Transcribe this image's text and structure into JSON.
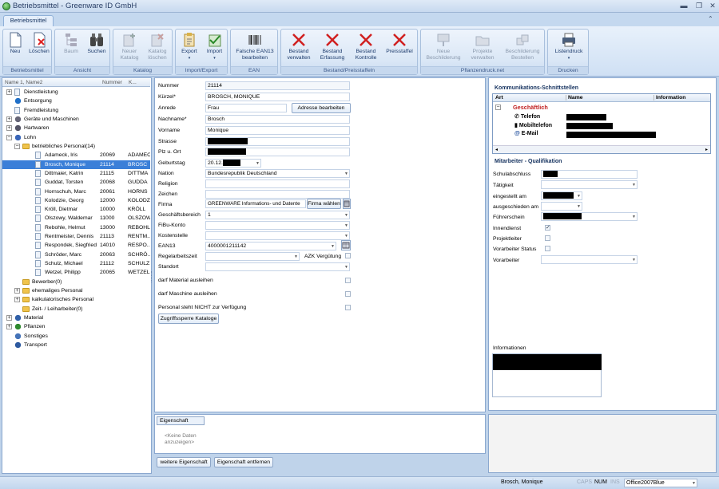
{
  "window": {
    "title": "Betriebsmittel - Greenware ID GmbH"
  },
  "ribbon": {
    "tab": "Betriebsmittel",
    "groups": [
      {
        "caption": "Betriebsmittel",
        "buttons": [
          "Neu",
          "Löschen"
        ]
      },
      {
        "caption": "Ansicht",
        "buttons": [
          "Baum",
          "Suchen"
        ]
      },
      {
        "caption": "Katalog",
        "buttons": [
          "Neuer Katalog",
          "Katalog löschen"
        ]
      },
      {
        "caption": "Import/Export",
        "buttons": [
          "Export",
          "Import"
        ]
      },
      {
        "caption": "EAN",
        "buttons": [
          "Falsche EAN13 bearbeiten"
        ]
      },
      {
        "caption": "Bestand/Preisstaffeln",
        "buttons": [
          "Bestand verwalten",
          "Bestand Erfassung",
          "Bestand Kontrolle",
          "Preisstaffel"
        ]
      },
      {
        "caption": "Pflanzendruck.net",
        "buttons": [
          "Neue Beschilderung",
          "Projekte verwalten",
          "Beschilderung Bestellen"
        ]
      },
      {
        "caption": "Drucken",
        "buttons": [
          "Listendruck"
        ]
      }
    ]
  },
  "tree": {
    "headers": [
      "Name 1, Name2",
      "Nummer",
      "K..."
    ],
    "items": [
      {
        "label": "Dienstleistung"
      },
      {
        "label": "Entsorgung"
      },
      {
        "label": "Fremdleistung"
      },
      {
        "label": "Geräte und Maschinen"
      },
      {
        "label": "Hartwaren"
      },
      {
        "label": "Lohn"
      },
      {
        "label": "betriebliches Personal(14)"
      },
      {
        "label": "Adameck, Iris",
        "num": "20069",
        "k": "ADAMEC"
      },
      {
        "label": "Brosch, Monique",
        "num": "21114",
        "k": "BROSC"
      },
      {
        "label": "Dittmaier, Katrin",
        "num": "21115",
        "k": "DITTMA"
      },
      {
        "label": "Guddat, Torsten",
        "num": "20068",
        "k": "GUDDA"
      },
      {
        "label": "Hornschuh, Marc",
        "num": "20061",
        "k": "HORNS"
      },
      {
        "label": "Kolodzie, Georg",
        "num": "12000",
        "k": "KOLODZI"
      },
      {
        "label": "Kröll, Dietmar",
        "num": "10000",
        "k": "KRÖLL"
      },
      {
        "label": "Olszowy, Waldemar",
        "num": "11000",
        "k": "OLSZOW"
      },
      {
        "label": "Rebohle, Helmut",
        "num": "13000",
        "k": "REBOHLE"
      },
      {
        "label": "Rentmeister, Dennis",
        "num": "21113",
        "k": "RENTM.."
      },
      {
        "label": "Respondek, Siegfried",
        "num": "14010",
        "k": "RESPO.."
      },
      {
        "label": "Schröder, Marc",
        "num": "20063",
        "k": "SCHRÖ.."
      },
      {
        "label": "Schulz, Michael",
        "num": "21112",
        "k": "SCHULZ.."
      },
      {
        "label": "Wetzel, Philipp",
        "num": "20065",
        "k": "WETZEL"
      },
      {
        "label": "Bewerber(0)"
      },
      {
        "label": "ehemaliges Personal"
      },
      {
        "label": "kalkulatorisches Personal"
      },
      {
        "label": "Zeit- / Leiharbeiter(0)"
      },
      {
        "label": "Material"
      },
      {
        "label": "Pflanzen"
      },
      {
        "label": "Sonstiges"
      },
      {
        "label": "Transport"
      }
    ]
  },
  "form": {
    "nummer_label": "Nummer",
    "nummer": "21114",
    "kuerzel_label": "Kürzel*",
    "kuerzel": "BROSCH, MONIQUE",
    "anrede_label": "Anrede",
    "anrede": "Frau",
    "adresse_button": "Adresse bearbeiten",
    "nachname_label": "Nachname*",
    "nachname": "Brosch",
    "vorname_label": "Vorname",
    "vorname": "Monique",
    "strasse_label": "Strasse",
    "plz_label": "Plz u. Ort",
    "geburtstag_label": "Geburtstag",
    "geburtstag": "20.12.",
    "nation_label": "Nation",
    "nation": "Bundesrepublik Deutschland",
    "religion_label": "Religion",
    "zeichen_label": "Zeichen",
    "firma_label": "Firma",
    "firma": "GREENWARE Informations- und Datente",
    "firma_button": "Firma wählen",
    "geschaeftsbereich_label": "Geschäftsbereich",
    "geschaeftsbereich": "1",
    "fibu_label": "FiBu-Konto",
    "kostenstelle_label": "Kostenstelle",
    "ean13_label": "EAN13",
    "ean13": "4000001211142",
    "regelarbeitszeit_label": "Regelarbeitszeit",
    "azk_label": "AZK Vergütung",
    "standort_label": "Standort",
    "material_label": "darf Material ausleihen",
    "maschine_label": "darf Maschine ausleihen",
    "personal_label": "Personal steht NICHT zur Verfügung",
    "zugriff_button": "Zugriffssperre Kataloge"
  },
  "eigenschaft": {
    "column": "Eigenschaft",
    "empty": "<Keine Daten anzuzeigen>",
    "add_button": "weitere Eigenschaft",
    "remove_button": "Eigenschaft entfernen"
  },
  "komm": {
    "title": "Kommunikations-Schnittstellen",
    "headers": [
      "Art",
      "Name",
      "Information"
    ],
    "group": "Geschäftlich",
    "items": [
      "Telefon",
      "Mobiltelefon",
      "E-Mail"
    ]
  },
  "quali": {
    "title": "Mitarbeiter - Qualifikation",
    "schulabschluss": "Schulabschluss",
    "taetigkeit": "Tätigkeit",
    "eingestellt": "eingestellt am",
    "ausgeschieden": "ausgeschieden am",
    "fuehrerschein": "Führerschein",
    "innendienst": "Innendienst",
    "projektleiter": "Projektleiter",
    "vorarbeiter_status": "Vorarbeiter Status",
    "vorarbeiter": "Vorarbeiter",
    "informationen": "Informationen"
  },
  "status": {
    "user": "Brosch, Monique",
    "caps": "CAPS",
    "num": "NUM",
    "ins": "INS",
    "theme": "Office2007Blue"
  }
}
